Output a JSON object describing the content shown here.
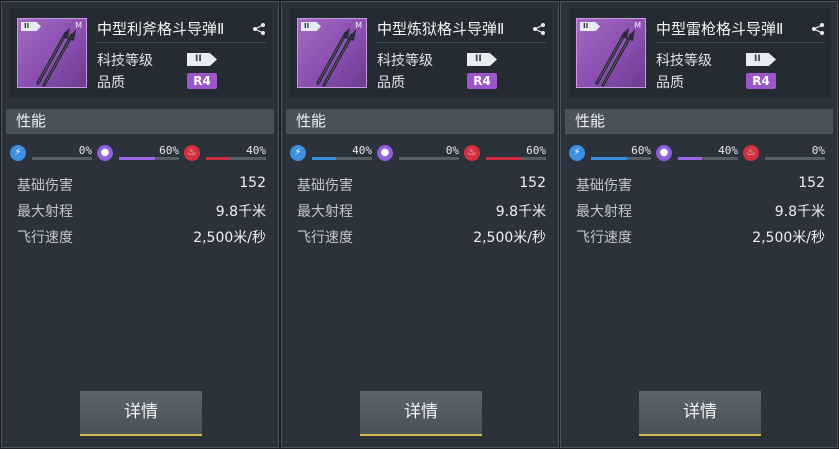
{
  "cards": [
    {
      "title": "中型利斧格斗导弹Ⅱ",
      "thumb_level": "II",
      "thumb_size": "M",
      "tech_label": "科技等级",
      "tech_value": "II",
      "quality_label": "品质",
      "quality_value": "R4",
      "perf_label": "性能",
      "damage": [
        {
          "type": "electric",
          "icon": "lightning-icon",
          "value": "0%",
          "fraction": 0.0
        },
        {
          "type": "kinetic",
          "icon": "kinetic-icon",
          "value": "60%",
          "fraction": 0.6
        },
        {
          "type": "thermal",
          "icon": "fire-icon",
          "value": "40%",
          "fraction": 0.4
        }
      ],
      "stats": [
        {
          "label": "基础伤害",
          "value": "152"
        },
        {
          "label": "最大射程",
          "value": "9.8千米"
        },
        {
          "label": "飞行速度",
          "value": "2,500米/秒"
        }
      ],
      "detail_label": "详情"
    },
    {
      "title": "中型炼狱格斗导弹Ⅱ",
      "thumb_level": "II",
      "thumb_size": "M",
      "tech_label": "科技等级",
      "tech_value": "II",
      "quality_label": "品质",
      "quality_value": "R4",
      "perf_label": "性能",
      "damage": [
        {
          "type": "electric",
          "icon": "lightning-icon",
          "value": "40%",
          "fraction": 0.4
        },
        {
          "type": "kinetic",
          "icon": "kinetic-icon",
          "value": "0%",
          "fraction": 0.0
        },
        {
          "type": "thermal",
          "icon": "fire-icon",
          "value": "60%",
          "fraction": 0.6
        }
      ],
      "stats": [
        {
          "label": "基础伤害",
          "value": "152"
        },
        {
          "label": "最大射程",
          "value": "9.8千米"
        },
        {
          "label": "飞行速度",
          "value": "2,500米/秒"
        }
      ],
      "detail_label": "详情"
    },
    {
      "title": "中型雷枪格斗导弹Ⅱ",
      "thumb_level": "II",
      "thumb_size": "M",
      "tech_label": "科技等级",
      "tech_value": "II",
      "quality_label": "品质",
      "quality_value": "R4",
      "perf_label": "性能",
      "damage": [
        {
          "type": "electric",
          "icon": "lightning-icon",
          "value": "60%",
          "fraction": 0.6
        },
        {
          "type": "kinetic",
          "icon": "kinetic-icon",
          "value": "40%",
          "fraction": 0.4
        },
        {
          "type": "thermal",
          "icon": "fire-icon",
          "value": "0%",
          "fraction": 0.0
        }
      ],
      "stats": [
        {
          "label": "基础伤害",
          "value": "152"
        },
        {
          "label": "最大射程",
          "value": "9.8千米"
        },
        {
          "label": "飞行速度",
          "value": "2,500米/秒"
        }
      ],
      "detail_label": "详情"
    }
  ],
  "colors": {
    "electric": "#3a8cdc",
    "kinetic": "#9a66e6",
    "thermal": "#cf2c3c",
    "quality_r4": "#9c56c9",
    "detail_accent": "#d6b94a"
  }
}
